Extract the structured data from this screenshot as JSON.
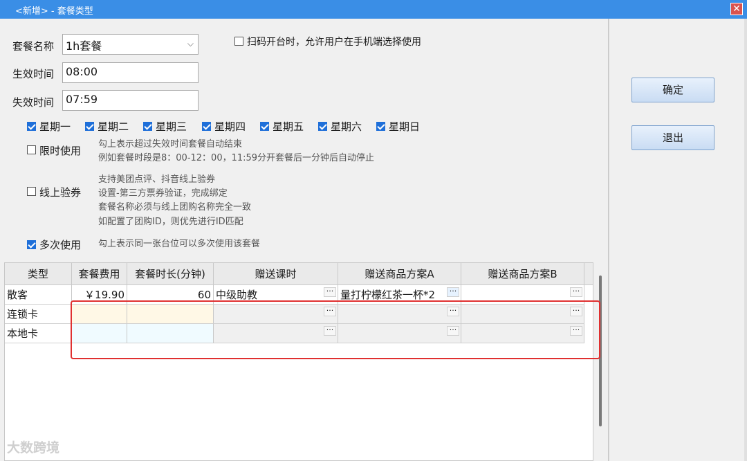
{
  "window": {
    "title": "<新增> - 套餐类型",
    "close_glyph": "✕"
  },
  "form": {
    "name_label": "套餐名称",
    "name_value": "1h套餐",
    "start_label": "生效时间",
    "start_value": "08:00",
    "end_label": "失效时间",
    "end_value": "07:59",
    "scan_option": {
      "label": "扫码开台时，允许用户在手机端选择使用",
      "checked": false
    },
    "weekdays": [
      {
        "label": "星期一",
        "checked": true
      },
      {
        "label": "星期二",
        "checked": true
      },
      {
        "label": "星期三",
        "checked": true
      },
      {
        "label": "星期四",
        "checked": true
      },
      {
        "label": "星期五",
        "checked": true
      },
      {
        "label": "星期六",
        "checked": true
      },
      {
        "label": "星期日",
        "checked": true
      }
    ],
    "limited": {
      "label": "限时使用",
      "checked": false,
      "hint1": "勾上表示超过失效时间套餐自动结束",
      "hint2": "例如套餐时段是8：00-12：00，11:59分开套餐后一分钟后自动停止"
    },
    "online": {
      "label": "线上验券",
      "checked": false,
      "hint1": "支持美团点评、抖音线上验券",
      "hint2": "设置-第三方票券验证，完成绑定",
      "hint3": "套餐名称必须与线上团购名称完全一致",
      "hint4": "如配置了团购ID，则优先进行ID匹配"
    },
    "multi": {
      "label": "多次使用",
      "checked": true,
      "hint": "勾上表示同一张台位可以多次使用该套餐"
    }
  },
  "buttons": {
    "ok": "确定",
    "exit": "退出"
  },
  "table": {
    "columns": [
      "类型",
      "套餐费用",
      "套餐时长(分钟)",
      "赠送课时",
      "赠送商品方案A",
      "赠送商品方案B"
    ],
    "rows": [
      [
        "散客",
        "￥19.90",
        "60",
        "中级助教",
        "量打柠檬红茶一杯*2",
        ""
      ],
      [
        "连锁卡",
        "",
        "",
        "",
        "",
        ""
      ],
      [
        "本地卡",
        "",
        "",
        "",
        "",
        ""
      ]
    ],
    "ellipsis": "···"
  },
  "watermark": "大数跨境",
  "colors": {
    "titlebar": "#3a8ee6",
    "highlight_box": "#e03030",
    "checkbox": "#1e6fd9",
    "row2_tint": "#fff8e6",
    "row3_tint": "#f0fbff"
  }
}
